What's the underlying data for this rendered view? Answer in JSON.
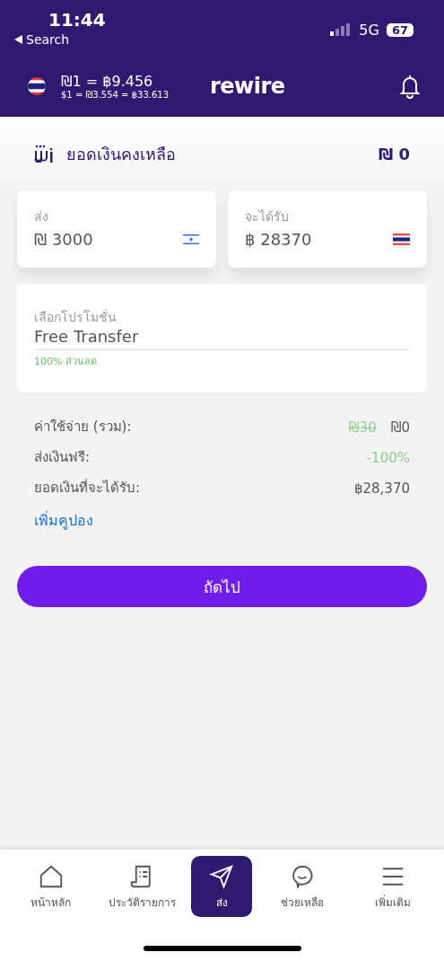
{
  "status_bar": {
    "time": "11:44",
    "back_label": "Search",
    "network": "5G",
    "battery": "67"
  },
  "header": {
    "rate": "₪1 = ฿9.456",
    "sub_rate": "$1 = ₪3.554 = ฿33.613",
    "logo": "rewire"
  },
  "balance": {
    "label": "ยอดเงินคงเหลือ",
    "amount": "₪ 0"
  },
  "send": {
    "label": "ส่ง",
    "value": "₪ 3000"
  },
  "receive": {
    "label": "จะได้รับ",
    "value": "฿ 28370"
  },
  "promotion": {
    "label": "เลือกโปรโมชั่น",
    "value": "Free Transfer",
    "hint": "100% ส่วนลด"
  },
  "summary": [
    {
      "label": "ค่าใช้จ่าย (รวม):",
      "old_value": "₪30",
      "value": "₪0",
      "kind": "fee"
    },
    {
      "label": "ส่งเงินฟรี:",
      "value": "-100%",
      "kind": "discount"
    },
    {
      "label": "ยอดเงินที่จะได้รับ:",
      "value": "฿28,370",
      "kind": "total"
    }
  ],
  "coupon_link": "เพิ่มคูปอง",
  "next_button": "ถัดไป",
  "tabs": [
    {
      "label": "หน้าหลัก",
      "kind": "home",
      "selected": false
    },
    {
      "label": "ประวัติรายการ",
      "kind": "history",
      "selected": false
    },
    {
      "label": "ส่ง",
      "kind": "send",
      "selected": true
    },
    {
      "label": "ช่วยเหลือ",
      "kind": "help",
      "selected": false
    },
    {
      "label": "เพิ่มเติม",
      "kind": "more",
      "selected": false
    }
  ]
}
